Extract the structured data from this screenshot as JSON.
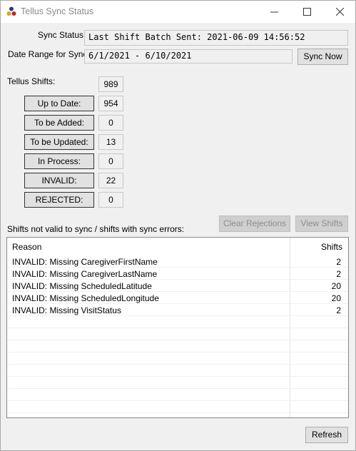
{
  "window": {
    "title": "Tellus Sync Status"
  },
  "sync_status": {
    "label": "Sync Status:",
    "value": "Last Shift Batch Sent: 2021-06-09 14:56:52"
  },
  "date_range": {
    "label": "Date Range for Sync:",
    "value": "6/1/2021 - 6/10/2021"
  },
  "sync_now_label": "Sync Now",
  "tellus_shifts": {
    "label": "Tellus Shifts:",
    "total": "989"
  },
  "status_buttons": [
    {
      "label": "Up to Date:",
      "count": "954"
    },
    {
      "label": "To be Added:",
      "count": "0"
    },
    {
      "label": "To be Updated:",
      "count": "13"
    },
    {
      "label": "In Process:",
      "count": "0"
    },
    {
      "label": "INVALID:",
      "count": "22"
    },
    {
      "label": "REJECTED:",
      "count": "0"
    }
  ],
  "errors_label": "Shifts not valid to sync / shifts with sync errors:",
  "clear_rejections_label": "Clear Rejections",
  "view_shifts_label": "View Shifts",
  "table": {
    "columns": [
      "Reason",
      "Shifts"
    ],
    "rows": [
      {
        "reason": "INVALID: Missing CaregiverFirstName",
        "shifts": "2"
      },
      {
        "reason": "INVALID: Missing CaregiverLastName",
        "shifts": "2"
      },
      {
        "reason": "INVALID: Missing ScheduledLatitude",
        "shifts": "20"
      },
      {
        "reason": "INVALID: Missing ScheduledLongitude",
        "shifts": "20"
      },
      {
        "reason": "INVALID: Missing VisitStatus",
        "shifts": "2"
      }
    ]
  },
  "refresh_label": "Refresh"
}
